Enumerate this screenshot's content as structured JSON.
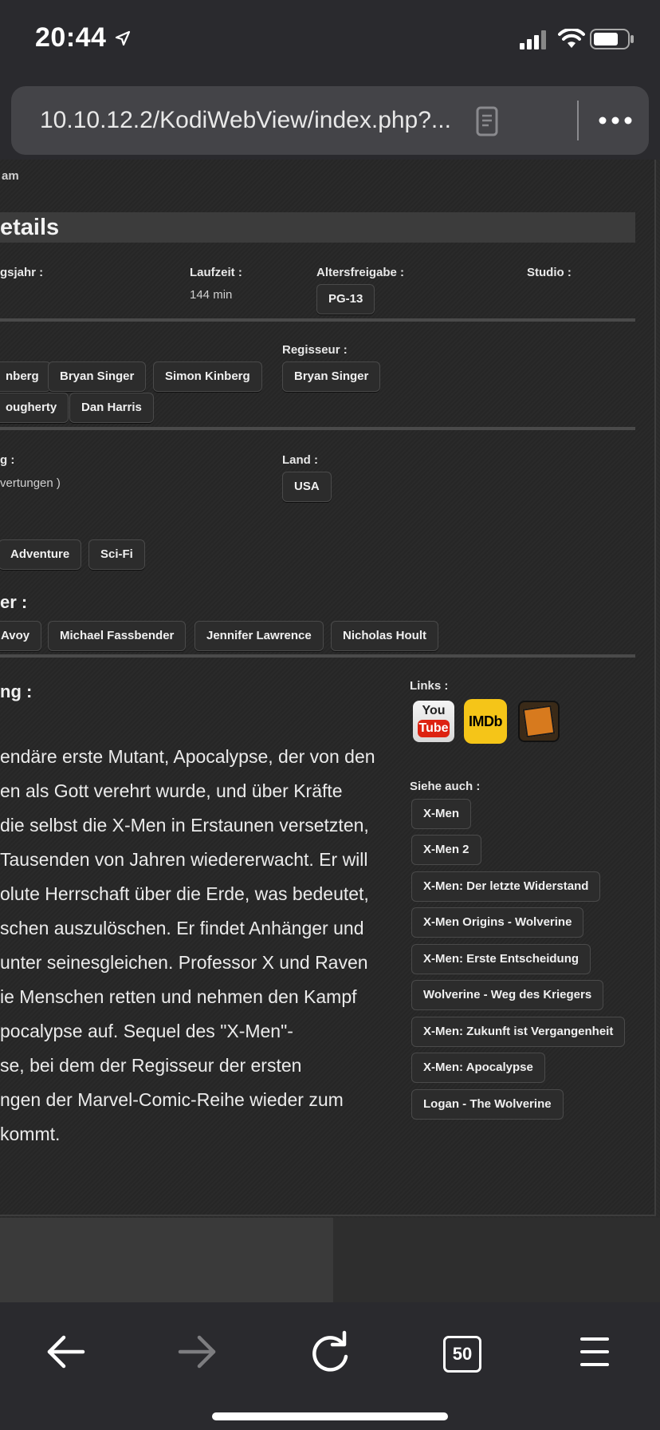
{
  "status_bar": {
    "time": "20:44"
  },
  "browser": {
    "url": "10.10.12.2/KodiWebView/index.php?...",
    "tabs_count": "50"
  },
  "page": {
    "top_fragment": "am",
    "details_title": "etails",
    "info": {
      "year_label": "gsjahr :",
      "runtime_label": "Laufzeit :",
      "runtime_value": "144 min",
      "rating_label": "Altersfreigabe :",
      "rating_value": "PG-13",
      "studio_label": "Studio :"
    },
    "writers": [
      "nberg",
      "Bryan Singer",
      "Simon Kinberg",
      "ougherty",
      "Dan Harris"
    ],
    "director_label": "Regisseur :",
    "director": "Bryan Singer",
    "rating2_label": "g :",
    "rating2_value": "vertungen )",
    "country_label": "Land :",
    "country": "USA",
    "genres": [
      "Adventure",
      "Sci-Fi"
    ],
    "cast_label": "er :",
    "cast": [
      "Avoy",
      "Michael Fassbender",
      "Jennifer Lawrence",
      "Nicholas Hoult"
    ],
    "plot_label": "ng :",
    "plot_lines": [
      "endäre erste Mutant, Apocalypse, der von den",
      "en als Gott verehrt wurde, und über Kräfte",
      "die selbst die X-Men in Erstaunen versetzten,",
      " Tausenden von Jahren wiedererwacht. Er will",
      "olute Herrschaft über die Erde, was bedeutet,",
      "schen auszulöschen. Er findet Anhänger und",
      "unter seinesgleichen. Professor X und Raven",
      "ie Menschen retten und nehmen den Kampf",
      "pocalypse auf. Sequel des \"X-Men\"-",
      "se, bei dem der Regisseur der ersten",
      "ngen der Marvel-Comic-Reihe wieder zum",
      "kommt."
    ],
    "links_label": "Links :",
    "links": {
      "youtube_you": "You",
      "youtube_tube": "Tube",
      "imdb": "IMDb"
    },
    "see_also_label": "Siehe auch :",
    "see_also": [
      "X-Men",
      "X-Men 2",
      "X-Men: Der letzte Widerstand",
      "X-Men Origins - Wolverine",
      "X-Men: Erste Entscheidung",
      "Wolverine - Weg des Kriegers",
      "X-Men: Zukunft ist Vergangenheit",
      "X-Men: Apocalypse",
      "Logan - The Wolverine"
    ]
  }
}
